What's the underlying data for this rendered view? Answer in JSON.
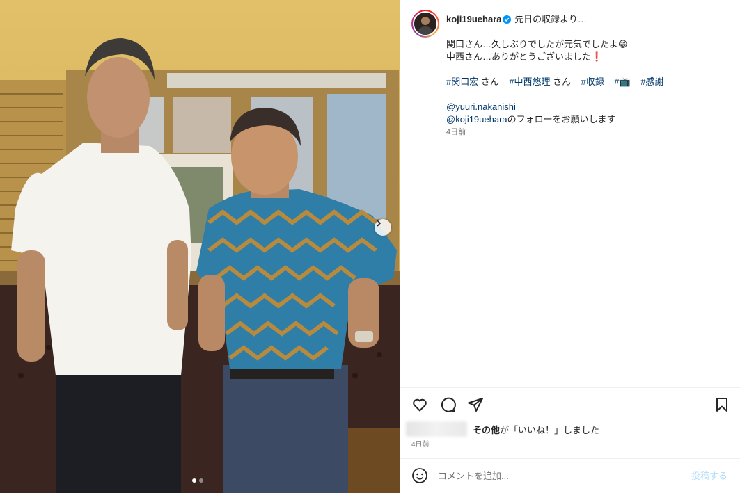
{
  "post": {
    "username": "koji19uehara",
    "caption_line1": "先日の収録より…",
    "body_line1": "関口さん…久しぶりでしたが元気でしたよ😁",
    "body_line2": "中西さん…ありがとうございました❗️",
    "hashtags": [
      {
        "tag": "#関口宏",
        "suffix": " さん"
      },
      {
        "tag": "#中西悠理",
        "suffix": " さん"
      },
      {
        "tag": "#収録",
        "suffix": ""
      },
      {
        "tag": "#📺",
        "suffix": ""
      },
      {
        "tag": "#感謝",
        "suffix": ""
      }
    ],
    "mention1": "@yuuri.nakanishi",
    "mention2": "@koji19uehara",
    "mention2_suffix": "のフォローをお願いします",
    "caption_time": "4日前"
  },
  "likes": {
    "others_label": "その他",
    "text": "が「いいね！」しました"
  },
  "post_time": "4日前",
  "comment": {
    "placeholder": "コメントを追加...",
    "post_label": "投稿する"
  },
  "carousel": {
    "total": 2,
    "current": 1
  },
  "icons": {
    "verified": "verified-badge-icon",
    "like": "heart-icon",
    "comment": "comment-icon",
    "share": "share-icon",
    "save": "bookmark-icon",
    "emoji": "emoji-icon",
    "next": "chevron-right-icon"
  },
  "colors": {
    "link": "#00376b",
    "verified": "#0095f6",
    "muted": "#737373",
    "post_button": "#b2dffc"
  }
}
